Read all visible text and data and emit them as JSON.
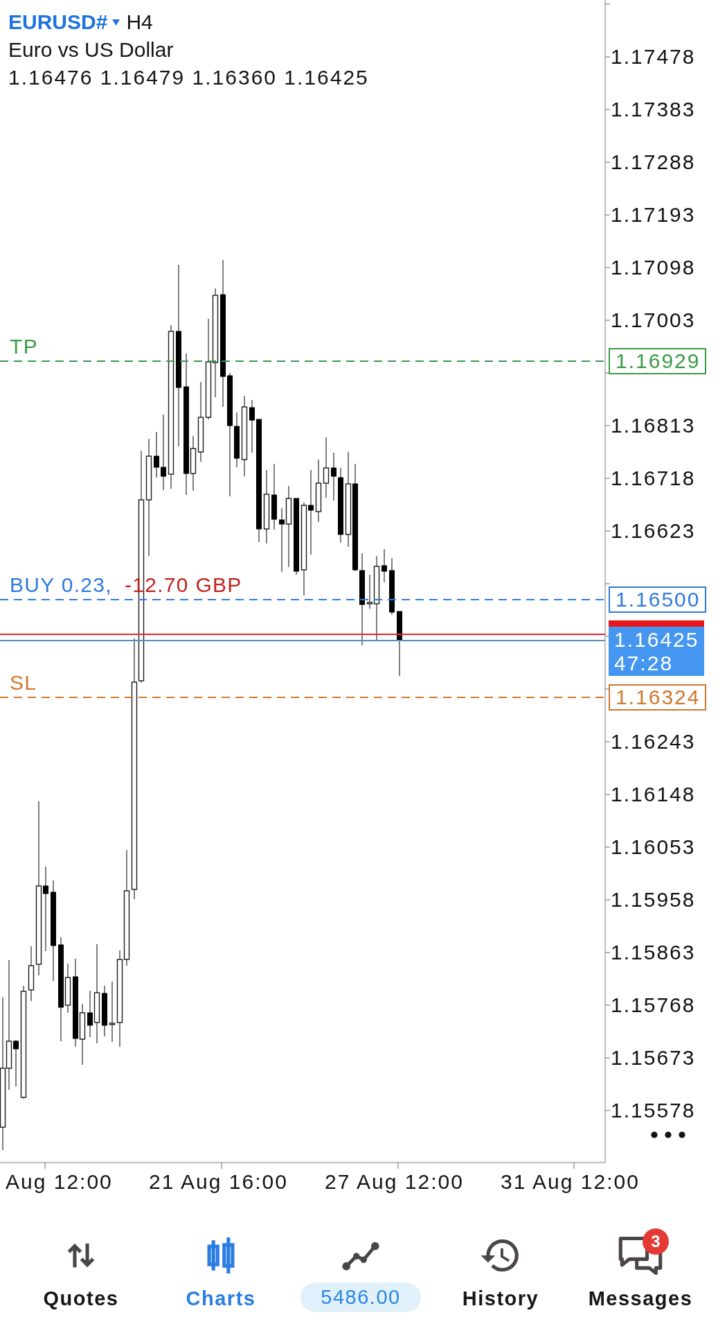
{
  "header": {
    "symbol": "EURUSD#",
    "timeframe": "H4",
    "description": "Euro vs US Dollar",
    "ohlc": "1.16476 1.16479 1.16360 1.16425"
  },
  "chart": {
    "price_axis": [
      "1.17478",
      "1.17383",
      "1.17288",
      "1.17193",
      "1.17098",
      "1.17003",
      "1.16813",
      "1.16718",
      "1.16623",
      "1.16243",
      "1.16148",
      "1.16053",
      "1.15958",
      "1.15863",
      "1.15768",
      "1.15673",
      "1.15578"
    ],
    "time_axis": [
      "Aug 12:00",
      "21 Aug 16:00",
      "27 Aug 12:00",
      "31 Aug 12:00"
    ],
    "levels": [
      {
        "kind": "tp",
        "label": "TP",
        "price": "1.16929",
        "color": "#3a9a46"
      },
      {
        "kind": "order",
        "label": "BUY 0.23,",
        "profit": "-12.70 GBP",
        "price": "1.16500",
        "color": "#2f7bdc"
      },
      {
        "kind": "sl",
        "label": "SL",
        "price": "1.16324",
        "color": "#cf782c"
      }
    ],
    "current_price": {
      "bid": "1.16425",
      "timer": "47:28"
    }
  },
  "tabs": [
    {
      "kind": "quotes",
      "label": "Quotes",
      "selected": false
    },
    {
      "kind": "charts",
      "label": "Charts",
      "selected": true
    },
    {
      "kind": "trade",
      "value": "5486.00",
      "selected": false
    },
    {
      "kind": "history",
      "label": "History",
      "selected": false
    },
    {
      "kind": "messages",
      "label": "Messages",
      "badge": "3",
      "selected": false
    }
  ]
}
